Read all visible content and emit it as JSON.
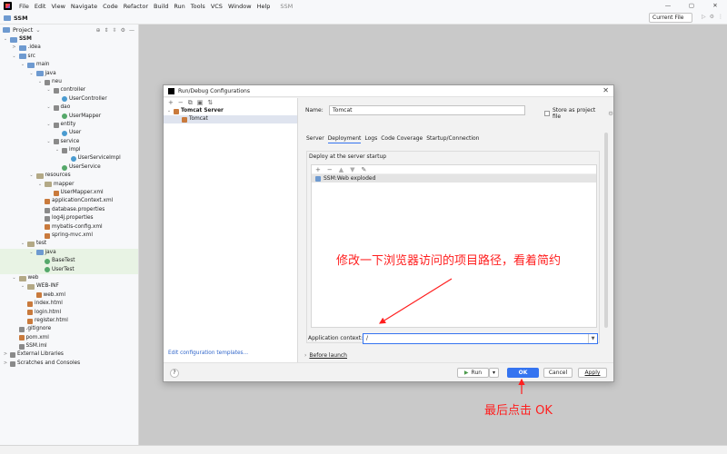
{
  "menubar": {
    "items": [
      "File",
      "Edit",
      "View",
      "Navigate",
      "Code",
      "Refactor",
      "Build",
      "Run",
      "Tools",
      "VCS",
      "Window",
      "Help"
    ],
    "project_name": "SSM"
  },
  "toolbar": {
    "project": "SSM",
    "run_config": "Current File"
  },
  "project_panel": {
    "title": "Project",
    "tree": [
      {
        "label": "SSM",
        "bold": true,
        "chev": "⌄",
        "depth": 0,
        "icon": "folder-icon"
      },
      {
        "label": ".idea",
        "chev": ">",
        "depth": 1,
        "icon": "folder-icon"
      },
      {
        "label": "src",
        "chev": "⌄",
        "depth": 1,
        "icon": "folder-icon"
      },
      {
        "label": "main",
        "chev": "⌄",
        "depth": 2,
        "icon": "folder-icon"
      },
      {
        "label": "java",
        "chev": "⌄",
        "depth": 3,
        "icon": "folder-icon"
      },
      {
        "label": "neu",
        "chev": "⌄",
        "depth": 4,
        "icon": "package-icon"
      },
      {
        "label": "controller",
        "chev": "⌄",
        "depth": 5,
        "icon": "package-icon"
      },
      {
        "label": "UserController",
        "chev": "",
        "depth": 6,
        "icon": "class-icon"
      },
      {
        "label": "dao",
        "chev": "⌄",
        "depth": 5,
        "icon": "package-icon"
      },
      {
        "label": "UserMapper",
        "chev": "",
        "depth": 6,
        "icon": "interface-icon"
      },
      {
        "label": "entity",
        "chev": "⌄",
        "depth": 5,
        "icon": "package-icon"
      },
      {
        "label": "User",
        "chev": "",
        "depth": 6,
        "icon": "class-icon"
      },
      {
        "label": "service",
        "chev": "⌄",
        "depth": 5,
        "icon": "package-icon"
      },
      {
        "label": "impl",
        "chev": "⌄",
        "depth": 6,
        "icon": "package-icon"
      },
      {
        "label": "UserServiceImpl",
        "chev": "",
        "depth": 7,
        "icon": "class-icon"
      },
      {
        "label": "UserService",
        "chev": "",
        "depth": 6,
        "icon": "interface-icon"
      },
      {
        "label": "resources",
        "chev": "⌄",
        "depth": 3,
        "icon": "folder-icon"
      },
      {
        "label": "mapper",
        "chev": "⌄",
        "depth": 4,
        "icon": "folder-icon"
      },
      {
        "label": "UserMapper.xml",
        "chev": "",
        "depth": 5,
        "icon": "xml-icon"
      },
      {
        "label": "applicationContext.xml",
        "chev": "",
        "depth": 4,
        "icon": "xml-icon"
      },
      {
        "label": "database.properties",
        "chev": "",
        "depth": 4,
        "icon": "properties-icon"
      },
      {
        "label": "log4j.properties",
        "chev": "",
        "depth": 4,
        "icon": "properties-icon"
      },
      {
        "label": "mybatis-config.xml",
        "chev": "",
        "depth": 4,
        "icon": "xml-icon"
      },
      {
        "label": "spring-mvc.xml",
        "chev": "",
        "depth": 4,
        "icon": "xml-icon"
      },
      {
        "label": "test",
        "chev": "⌄",
        "depth": 2,
        "icon": "folder-icon"
      },
      {
        "label": "java",
        "chev": "⌄",
        "depth": 3,
        "icon": "folder-icon",
        "hl": true
      },
      {
        "label": "BaseTest",
        "chev": "",
        "depth": 4,
        "icon": "test-class-icon",
        "hl": true
      },
      {
        "label": "UserTest",
        "chev": "",
        "depth": 4,
        "icon": "test-class-icon",
        "hl": true
      },
      {
        "label": "web",
        "chev": "⌄",
        "depth": 1,
        "icon": "folder-icon"
      },
      {
        "label": "WEB-INF",
        "chev": "⌄",
        "depth": 2,
        "icon": "folder-icon"
      },
      {
        "label": "web.xml",
        "chev": "",
        "depth": 3,
        "icon": "xml-icon"
      },
      {
        "label": "index.html",
        "chev": "",
        "depth": 2,
        "icon": "html-icon"
      },
      {
        "label": "login.html",
        "chev": "",
        "depth": 2,
        "icon": "html-icon"
      },
      {
        "label": "register.html",
        "chev": "",
        "depth": 2,
        "icon": "html-icon"
      },
      {
        "label": ".gitignore",
        "chev": "",
        "depth": 1,
        "icon": "file-icon"
      },
      {
        "label": "pom.xml",
        "chev": "",
        "depth": 1,
        "icon": "maven-icon"
      },
      {
        "label": "SSM.iml",
        "chev": "",
        "depth": 1,
        "icon": "file-icon"
      },
      {
        "label": "External Libraries",
        "chev": ">",
        "depth": 0,
        "icon": "library-icon"
      },
      {
        "label": "Scratches and Consoles",
        "chev": ">",
        "depth": 0,
        "icon": "scratch-icon"
      }
    ]
  },
  "dialog": {
    "title": "Run/Debug Configurations",
    "left_tree": [
      {
        "label": "Tomcat Server",
        "bold": true,
        "chev": "⌄",
        "depth": 0
      },
      {
        "label": "Tomcat",
        "bold": false,
        "chev": "",
        "depth": 1,
        "selected": true
      }
    ],
    "edit_templates": "Edit configuration templates...",
    "name_label": "Name:",
    "name_value": "Tomcat",
    "store_label": "Store as project file",
    "tabs": [
      "Server",
      "Deployment",
      "Logs",
      "Code Coverage",
      "Startup/Connection"
    ],
    "active_tab": "Deployment",
    "group_title": "Deploy at the server startup",
    "artifact": "SSM:Web exploded",
    "context_label": "Application context:",
    "context_value": "/",
    "before_launch": "Before launch",
    "buttons": {
      "run": "Run",
      "ok": "OK",
      "cancel": "Cancel",
      "apply": "Apply",
      "help": "?"
    }
  },
  "annotations": {
    "note1": "修改一下浏览器访问的项目路径，看着简约",
    "note2": "最后点击 OK"
  },
  "colors": {
    "accent": "#3574f0",
    "annotation": "#ff1e1e"
  }
}
